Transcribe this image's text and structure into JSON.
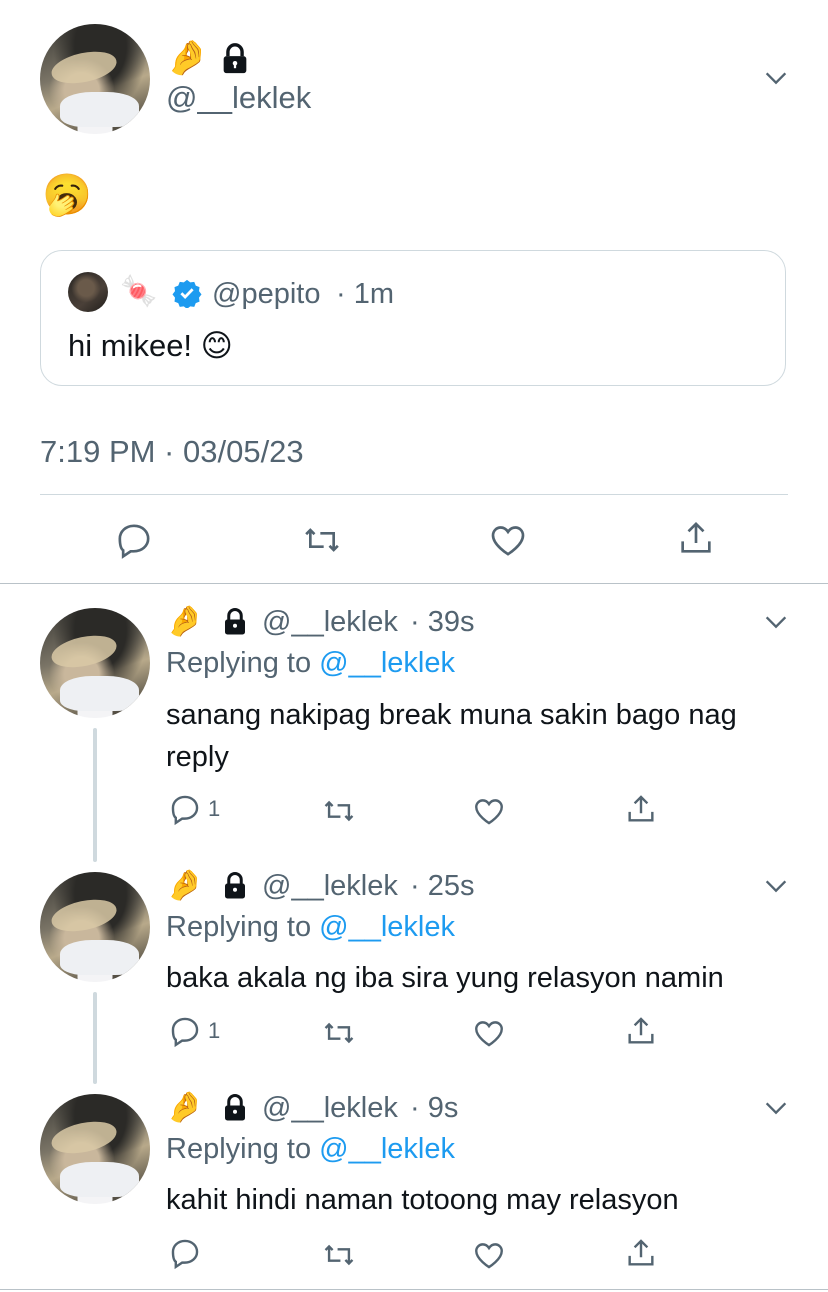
{
  "main_tweet": {
    "name_emoji": "🤌",
    "lock_icon": "lock-icon",
    "handle": "@__leklek",
    "body_emoji": "🥱",
    "quoted": {
      "name_emoji": "🍬",
      "verified": "verified-badge-icon",
      "handle": "@pepito",
      "time": "· 1m",
      "text": "hi mikee! 😊"
    },
    "timestamp": "7:19 PM · 03/05/23"
  },
  "replies": [
    {
      "name_emoji": "🤌",
      "handle": "@__leklek",
      "time": "· 39s",
      "replying_prefix": "Replying to",
      "replying_to": "@__leklek",
      "text": "sanang nakipag break muna sakin bago nag reply",
      "reply_count": "1"
    },
    {
      "name_emoji": "🤌",
      "handle": "@__leklek",
      "time": "· 25s",
      "replying_prefix": "Replying to",
      "replying_to": "@__leklek",
      "text": "baka akala ng iba sira yung relasyon namin",
      "reply_count": "1"
    },
    {
      "name_emoji": "🤌",
      "handle": "@__leklek",
      "time": "· 9s",
      "replying_prefix": "Replying to",
      "replying_to": "@__leklek",
      "text": "kahit hindi naman totoong may relasyon",
      "reply_count": ""
    }
  ],
  "colors": {
    "text": "#0f1419",
    "secondary": "#536471",
    "accent": "#1d9bf0",
    "divider": "#cfd9de"
  }
}
